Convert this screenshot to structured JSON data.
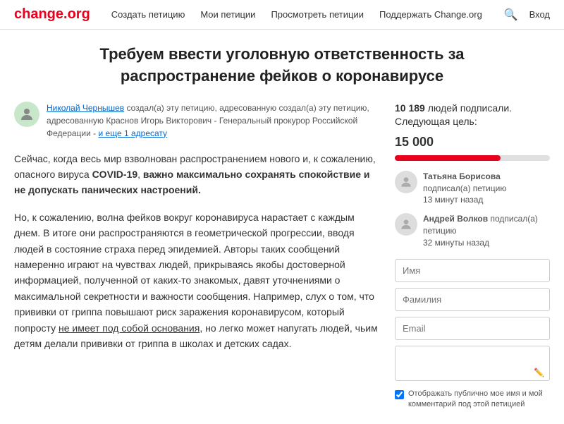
{
  "header": {
    "logo": "change.org",
    "nav": [
      {
        "label": "Создать петицию"
      },
      {
        "label": "Мои петиции"
      },
      {
        "label": "Просмотреть петиции"
      },
      {
        "label": "Поддержать Change.org"
      }
    ],
    "login": "Вход"
  },
  "petition": {
    "title": "Требуем ввести уголовную ответственность за распространение фейков о коронавирусе",
    "author": {
      "name": "Николай Чернышев",
      "action": "создал(а) эту петицию, адресованную Краснов Игорь Викторович - Генеральный прокурор Российской Федерации",
      "extra_link": "и еще 1 адресату"
    },
    "body_1": "Сейчас, когда весь мир взволнован распространением нового и, к сожалению, опасного вируса COVID-19, важно максимально сохранять спокойствие и не допускать панических настроений.",
    "body_2": "Но, к сожалению, волна фейков вокруг коронавируса нарастает с каждым днем. В итоге они распространяются в геометрической прогрессии, вводя людей в состояние страха перед эпидемией. Авторы таких сообщений намеренно играют на чувствах людей, прикрываясь якобы достоверной информацией, полученной от каких-то знакомых, давят уточнениями о максимальной секретности и важности сообщения. Например, слух о том, что прививки от гриппа повышают риск заражения коронавирусом, который попросту ",
    "body_2_underline": "не имеет под собой основания",
    "body_2_end": ", но легко может напугать людей, чьим детям делали прививки от гриппа в школах и детских садах."
  },
  "sidebar": {
    "signatures_text": "людей подписали. Следующая цель:",
    "count": "10 189",
    "goal": "15 000",
    "progress_percent": 68,
    "signers": [
      {
        "name": "Татьяна Борисова",
        "action": "подписал(а) петицию",
        "time": "13 минут назад"
      },
      {
        "name": "Андрей Волков",
        "action": "подписал(а) петицию",
        "time": "32 минуты назад"
      }
    ],
    "form": {
      "name_placeholder": "Имя",
      "surname_placeholder": "Фамилия",
      "email_placeholder": "Email",
      "checkbox_label": "Отображать публично мое имя и мой комментарий под этой петицией"
    }
  }
}
